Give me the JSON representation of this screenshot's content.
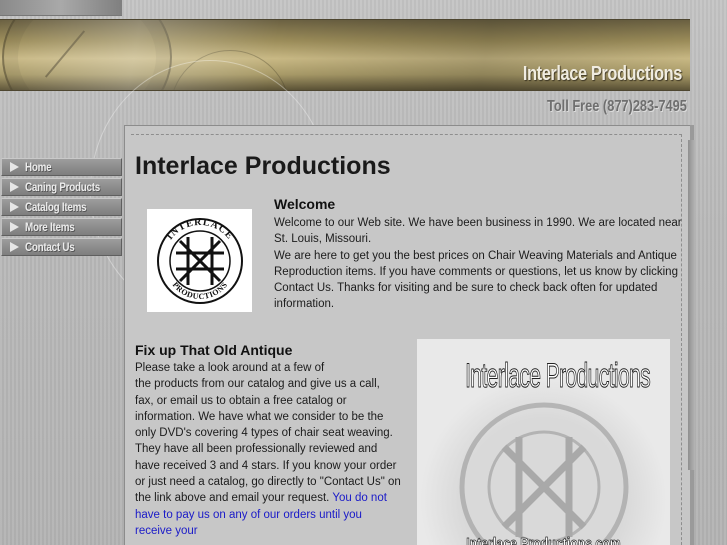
{
  "header": {
    "site_name": "Interlace Productions",
    "toll_free": "Toll Free (877)283-7495"
  },
  "nav": {
    "items": [
      {
        "label": "Home"
      },
      {
        "label": "Caning Products"
      },
      {
        "label": "Catalog Items"
      },
      {
        "label": "More Items"
      },
      {
        "label": "Contact Us"
      }
    ]
  },
  "main": {
    "page_title": "Interlace Productions",
    "logo": {
      "icon": "interlace-knot-logo",
      "text_top": "INTERLACE",
      "text_bottom": "PRODUCTIONS"
    },
    "welcome": {
      "heading": "Welcome",
      "paragraph1": "Welcome to our Web site. We have been business in 1990. We are located near St. Louis, Missouri.",
      "paragraph2": "We are here to get you the best prices on Chair Weaving Materials and Antique Reproduction items. If you have comments or questions, let us know by clicking Contact Us. Thanks for visiting and be sure to check back often for updated information."
    },
    "antique": {
      "heading": "Fix up That Old Antique",
      "line1": "Please take a look around at a few of",
      "body": "the products from our catalog and give us a call, fax, or email us to obtain a free catalog or information. We have what we consider to be the only DVD's covering 4 types of chair seat weaving.  They have all been professionally reviewed and have received 3 and 4 stars.  If you know your order or just need a catalog, go directly to \"Contact Us\" on the link above and email your request.",
      "highlight": "You do not have to pay us on any of our orders until you receive your"
    },
    "catalog_image": {
      "title": "Interlace Productions",
      "footer": "Interlace Productions.com"
    }
  },
  "colors": {
    "banner_gold": "#c8b884",
    "nav_button": "#8d8d8d",
    "panel_bg": "#c7c7c7",
    "link_blue": "#1a1ac8"
  }
}
